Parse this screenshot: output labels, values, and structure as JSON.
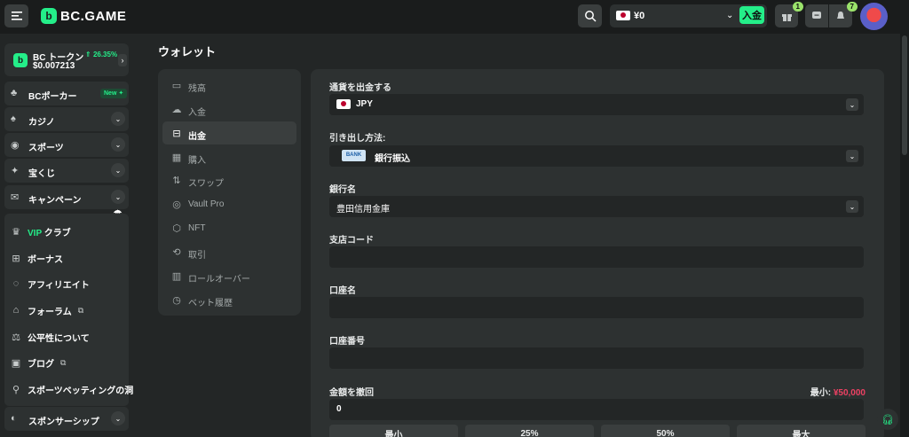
{
  "header": {
    "logo": "BC.GAME",
    "balance": "¥0",
    "deposit_label": "入金",
    "gift_count": "1",
    "notif_count": "7"
  },
  "sidebar": {
    "token": {
      "name": "BC トークン",
      "change": "26.35%",
      "price": "$0.007213"
    },
    "items": [
      {
        "label": "BCポーカー",
        "icon": "poker-icon",
        "badge": "New"
      },
      {
        "label": "カジノ",
        "icon": "casino-icon"
      },
      {
        "label": "スポーツ",
        "icon": "sports-icon"
      },
      {
        "label": "宝くじ",
        "icon": "lottery-icon"
      },
      {
        "label": "キャンペーン",
        "icon": "campaign-icon"
      }
    ],
    "links": [
      {
        "label_vip": "VIP",
        "label": " クラブ",
        "icon": "vip-icon"
      },
      {
        "label": "ボーナス",
        "icon": "bonus-icon"
      },
      {
        "label": "アフィリエイト",
        "icon": "affiliate-icon"
      },
      {
        "label": "フォーラム",
        "icon": "forum-icon"
      },
      {
        "label": "公平性について",
        "icon": "fairness-icon"
      },
      {
        "label": "ブログ",
        "icon": "blog-icon"
      },
      {
        "label": "スポーツベッティングの洞",
        "icon": "insight-icon"
      }
    ],
    "sponsor": "スポンサーシップ"
  },
  "wallet": {
    "title": "ウォレット",
    "nav": [
      {
        "label": "残高",
        "icon": "balance-icon"
      },
      {
        "label": "入金",
        "icon": "deposit-icon"
      },
      {
        "label": "出金",
        "icon": "withdraw-icon",
        "active": true
      },
      {
        "label": "購入",
        "icon": "buy-icon"
      },
      {
        "label": "スワップ",
        "icon": "swap-icon"
      },
      {
        "label": "Vault Pro",
        "icon": "vault-icon"
      },
      {
        "label": "NFT",
        "icon": "nft-icon"
      },
      {
        "label": "取引",
        "icon": "transaction-icon"
      },
      {
        "label": "ロールオーバー",
        "icon": "rollover-icon"
      },
      {
        "label": "ベット履歴",
        "icon": "history-icon"
      }
    ]
  },
  "form": {
    "currency_label": "通貨を出金する",
    "currency_value": "JPY",
    "method_label": "引き出し方法:",
    "method_icon_text": "BANK",
    "method_value": "銀行振込",
    "bank_label": "銀行名",
    "bank_value": "豊田信用金庫",
    "branch_label": "支店コード",
    "account_name_label": "口座名",
    "account_number_label": "口座番号",
    "amount_label": "金額を撤回",
    "min_label": "最小:",
    "min_value": "¥50,000",
    "amount_value": "0",
    "quick_buttons": [
      "最小",
      "25%",
      "50%",
      "最大"
    ]
  }
}
